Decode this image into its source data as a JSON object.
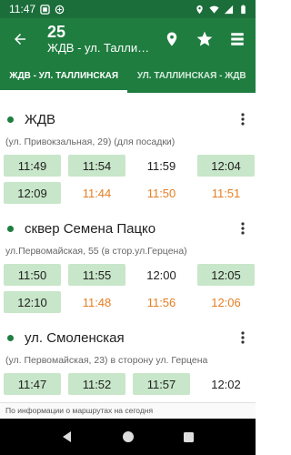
{
  "status": {
    "time": "11:47"
  },
  "header": {
    "title": "25",
    "subtitle": "ЖДВ - ул. Таллинская"
  },
  "tabs": [
    {
      "label": "ЖДВ - УЛ. ТАЛЛИНСКАЯ"
    },
    {
      "label": "УЛ. ТАЛЛИНСКАЯ - ЖДВ"
    }
  ],
  "stops": [
    {
      "name": "ЖДВ",
      "address": "(ул. Привокзальная, 29) (для посадки)",
      "times": [
        {
          "t": "11:49",
          "kind": "sched"
        },
        {
          "t": "11:54",
          "kind": "sched"
        },
        {
          "t": "11:59",
          "kind": "plain"
        },
        {
          "t": "12:04",
          "kind": "sched"
        },
        {
          "t": "12:09",
          "kind": "sched"
        },
        {
          "t": "11:44",
          "kind": "est"
        },
        {
          "t": "11:50",
          "kind": "est"
        },
        {
          "t": "11:51",
          "kind": "est"
        }
      ]
    },
    {
      "name": "сквер Семена Пацко",
      "address": "ул.Первомайская, 55 (в стор.ул.Герцена)",
      "times": [
        {
          "t": "11:50",
          "kind": "sched"
        },
        {
          "t": "11:55",
          "kind": "sched"
        },
        {
          "t": "12:00",
          "kind": "plain"
        },
        {
          "t": "12:05",
          "kind": "sched"
        },
        {
          "t": "12:10",
          "kind": "sched"
        },
        {
          "t": "11:48",
          "kind": "est"
        },
        {
          "t": "11:56",
          "kind": "est"
        },
        {
          "t": "12:06",
          "kind": "est"
        }
      ]
    },
    {
      "name": "ул. Смоленская",
      "address": "(ул. Первомайская, 23) в сторону ул. Герцена",
      "times": [
        {
          "t": "11:47",
          "kind": "sched"
        },
        {
          "t": "11:52",
          "kind": "sched"
        },
        {
          "t": "11:57",
          "kind": "sched"
        },
        {
          "t": "12:02",
          "kind": "plain"
        }
      ]
    }
  ],
  "footer": {
    "text": "По информации о маршрутах на сегодня"
  },
  "colors": {
    "primary": "#1f7d40",
    "statusbar": "#1b6e3a",
    "scheduled_bg": "#c8e6c9",
    "estimate": "#e67e22"
  }
}
